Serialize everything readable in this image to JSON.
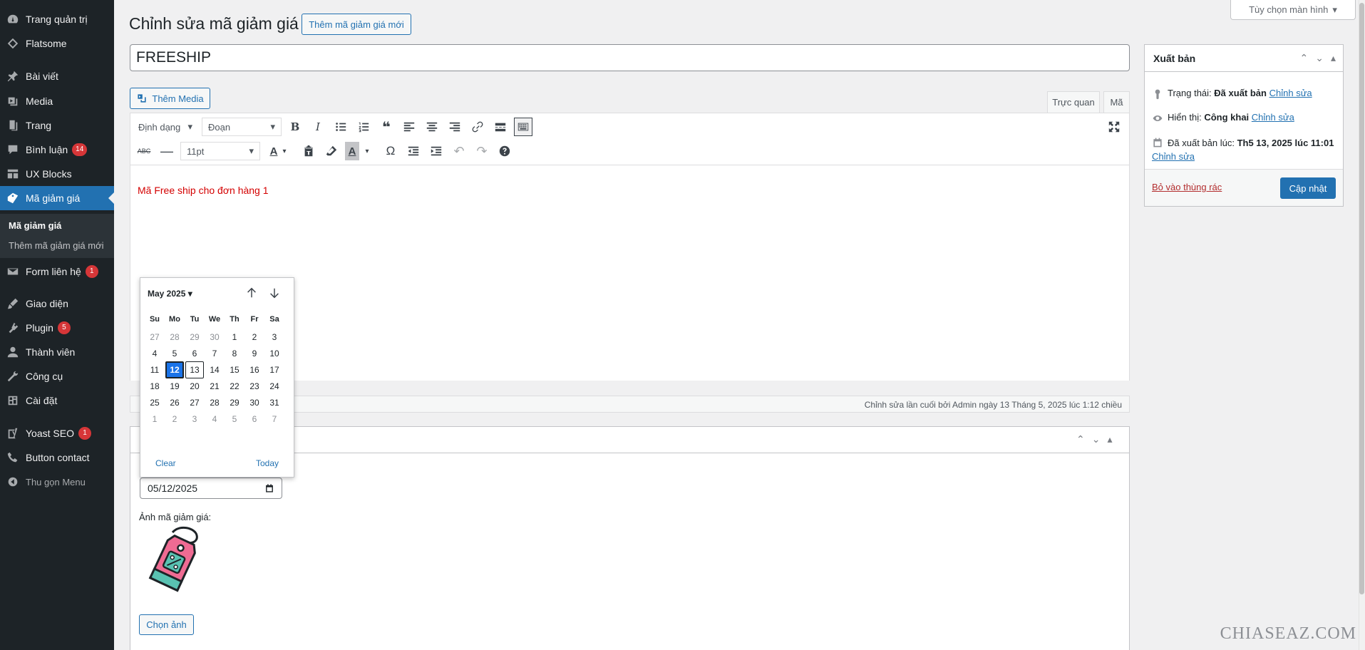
{
  "sidebar": {
    "items": [
      {
        "label": "Trang quản trị",
        "icon": "dashboard-icon"
      },
      {
        "label": "Flatsome",
        "icon": "flatsome-icon"
      },
      {
        "label": "Bài viết",
        "icon": "pin-icon"
      },
      {
        "label": "Media",
        "icon": "media-icon"
      },
      {
        "label": "Trang",
        "icon": "page-icon"
      },
      {
        "label": "Bình luận",
        "icon": "comment-icon",
        "badge": "14"
      },
      {
        "label": "UX Blocks",
        "icon": "blocks-icon"
      },
      {
        "label": "Mã giảm giá",
        "icon": "coupon-icon"
      },
      {
        "label": "Form liên hệ",
        "icon": "mail-icon",
        "badge": "1"
      },
      {
        "label": "Giao diện",
        "icon": "brush-icon"
      },
      {
        "label": "Plugin",
        "icon": "plugin-icon",
        "badge": "5"
      },
      {
        "label": "Thành viên",
        "icon": "user-icon"
      },
      {
        "label": "Công cụ",
        "icon": "wrench-icon"
      },
      {
        "label": "Cài đặt",
        "icon": "settings-icon"
      },
      {
        "label": "Yoast SEO",
        "icon": "yoast-icon",
        "badge": "1"
      },
      {
        "label": "Button contact",
        "icon": "phone-icon"
      },
      {
        "label": "Thu gọn Menu",
        "icon": "collapse-icon"
      }
    ],
    "submenu": [
      "Mã giảm giá",
      "Thêm mã giảm giá mới"
    ]
  },
  "header": {
    "title": "Chỉnh sửa mã giảm giá",
    "add_new": "Thêm mã giảm giá mới",
    "screen_options": "Tùy chọn màn hình"
  },
  "post": {
    "title_value": "FREESHIP"
  },
  "editor": {
    "add_media": "Thêm Media",
    "tab_visual": "Trực quan",
    "tab_code": "Mã",
    "format_label": "Định dạng",
    "block_select": "Đoạn",
    "font_size": "11pt",
    "content": "Mã Free ship cho đơn hàng 1",
    "last_edit": "Chỉnh sửa lần cuối bởi Admin ngày 13 Tháng 5, 2025 lúc 1:12 chiều"
  },
  "metabox": {
    "date_value": "05/12/2025",
    "image_label": "Ảnh mã giảm giá:",
    "choose_image": "Chọn ảnh"
  },
  "publish": {
    "title": "Xuất bản",
    "status_label": "Trạng thái:",
    "status_value": "Đã xuất bản",
    "visibility_label": "Hiển thị:",
    "visibility_value": "Công khai",
    "published_label": "Đã xuất bản lúc:",
    "published_value": "Th5 13, 2025 lúc 11:01",
    "edit_link": "Chỉnh sửa",
    "trash": "Bỏ vào thùng rác",
    "update": "Cập nhật"
  },
  "datepicker": {
    "month": "May 2025",
    "days_of_week": [
      "Su",
      "Mo",
      "Tu",
      "We",
      "Th",
      "Fr",
      "Sa"
    ],
    "weeks": [
      [
        "27",
        "28",
        "29",
        "30",
        "1",
        "2",
        "3"
      ],
      [
        "4",
        "5",
        "6",
        "7",
        "8",
        "9",
        "10"
      ],
      [
        "11",
        "12",
        "13",
        "14",
        "15",
        "16",
        "17"
      ],
      [
        "18",
        "19",
        "20",
        "21",
        "22",
        "23",
        "24"
      ],
      [
        "25",
        "26",
        "27",
        "28",
        "29",
        "30",
        "31"
      ],
      [
        "1",
        "2",
        "3",
        "4",
        "5",
        "6",
        "7"
      ]
    ],
    "selected": "12",
    "today": "13",
    "clear": "Clear",
    "today_label": "Today"
  },
  "watermark": "CHIASEAZ.COM",
  "colors": {
    "sidebar_bg": "#1d2327",
    "accent": "#2271b1",
    "badge": "#d63638",
    "editor_text": "#d40000",
    "selected_day": "#1a73e8"
  }
}
